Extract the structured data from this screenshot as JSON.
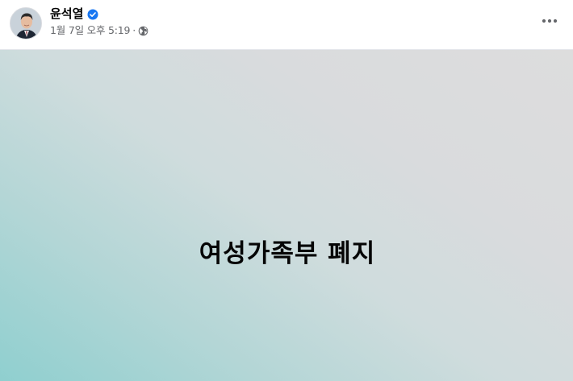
{
  "post": {
    "author": {
      "name": "윤석열",
      "verified": true
    },
    "timestamp": "1월 7일 오후 5:19",
    "separator": "·",
    "audience_icon": "globe-icon",
    "more_icon": "more-horizontal-icon",
    "body_text": "여성가족부 폐지",
    "colors": {
      "verified_badge": "#1877f2",
      "meta_text": "#65676b",
      "gradient_start": "#8fcfcf",
      "gradient_end": "#dddddd"
    }
  }
}
